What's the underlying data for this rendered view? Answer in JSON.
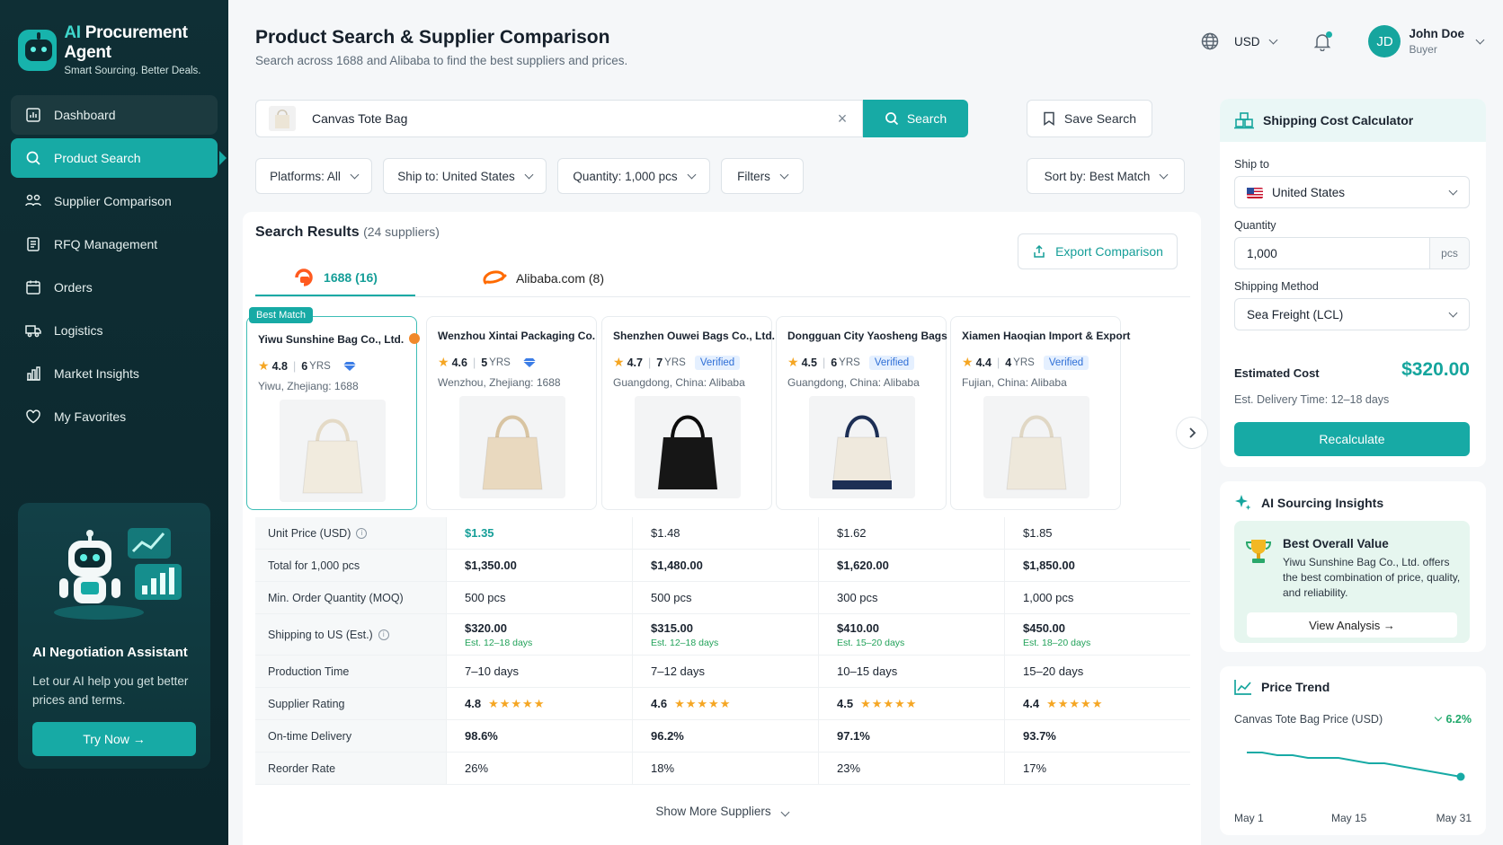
{
  "brand": {
    "title_prefix": "AI",
    "title_rest": " Procurement Agent",
    "subtitle": "Smart Sourcing. Better Deals."
  },
  "nav": [
    {
      "label": "Dashboard",
      "icon": "dashboard-icon"
    },
    {
      "label": "Product Search",
      "icon": "search-icon",
      "active": true
    },
    {
      "label": "Supplier Comparison",
      "icon": "supplier-comparison-icon"
    },
    {
      "label": "RFQ Management",
      "icon": "rfq-icon"
    },
    {
      "label": "Orders",
      "icon": "orders-icon"
    },
    {
      "label": "Logistics",
      "icon": "truck-icon"
    },
    {
      "label": "Market Insights",
      "icon": "chart-icon"
    },
    {
      "label": "My Favorites",
      "icon": "heart-icon"
    }
  ],
  "assistant": {
    "title": "AI Negotiation Assistant",
    "desc": "Let our AI help you get better prices and terms.",
    "button": "Try Now →"
  },
  "header": {
    "title": "Product Search & Supplier Comparison",
    "subtitle": "Search across 1688 and Alibaba to find the best suppliers and prices.",
    "currency": "USD",
    "user_initials": "JD",
    "user_name": "John Doe",
    "user_role": "Buyer"
  },
  "search": {
    "value": "Canvas Tote Bag",
    "button": "Search",
    "save": "Save Search"
  },
  "filters": {
    "platforms": "Platforms: All",
    "ship_to": "Ship to: United States",
    "quantity": "Quantity: 1,000 pcs",
    "filters": "Filters",
    "sort": "Sort by: Best Match"
  },
  "results": {
    "title": "Search Results",
    "count": "(24 suppliers)",
    "export": "Export Comparison",
    "tabs": {
      "t1688": "1688 (16)",
      "alibaba": "Alibaba.com (8)"
    },
    "best_tag": "Best Match",
    "show_more": "Show More Suppliers"
  },
  "suppliers": [
    {
      "name": "Yiwu Sunshine Bag Co., Ltd.",
      "rating": "4.8",
      "years": "6",
      "badge": "diamond",
      "location": "Yiwu, Zhejiang: 1688",
      "bag_color": "#f1ebde",
      "handle": "#e4dac6"
    },
    {
      "name": "Wenzhou Xintai Packaging Co.",
      "rating": "4.6",
      "years": "5",
      "badge": "diamond",
      "location": "Wenzhou, Zhejiang: 1688",
      "bag_color": "#e9d9bf",
      "handle": "#d8c4a2"
    },
    {
      "name": "Shenzhen Ouwei Bags Co., Ltd.",
      "rating": "4.7",
      "years": "7",
      "badge": "verified",
      "location": "Guangdong, China: Alibaba",
      "bag_color": "#161616",
      "handle": "#0c0c0c"
    },
    {
      "name": "Dongguan City Yaosheng Bags",
      "rating": "4.5",
      "years": "6",
      "badge": "verified",
      "location": "Guangdong, China: Alibaba",
      "bag_color": "#efe9dd",
      "handle": "#1d2f55"
    },
    {
      "name": "Xiamen Haoqian Import & Export",
      "rating": "4.4",
      "years": "4",
      "badge": "verified",
      "location": "Fujian, China: Alibaba",
      "bag_color": "#eee8db",
      "handle": "#e0d7c4"
    }
  ],
  "labels": {
    "yrs": "YRS",
    "verified": "Verified"
  },
  "table": {
    "rows": [
      {
        "label": "Unit Price (USD)",
        "info": true,
        "values": [
          "$1.35",
          "$1.48",
          "$1.62",
          "$1.85"
        ],
        "style": "price"
      },
      {
        "label": "Total for 1,000 pcs",
        "values": [
          "$1,350.00",
          "$1,480.00",
          "$1,620.00",
          "$1,850.00"
        ],
        "style": "bold"
      },
      {
        "label": "Min. Order Quantity (MOQ)",
        "values": [
          "500 pcs",
          "500 pcs",
          "300 pcs",
          "1,000 pcs"
        ],
        "style": "normal"
      },
      {
        "label": "Shipping to US (Est.)",
        "info": true,
        "values": [
          "$320.00",
          "$315.00",
          "$410.00",
          "$450.00"
        ],
        "subs": [
          "Est. 12–18 days",
          "Est. 12–18 days",
          "Est. 15–20 days",
          "Est. 18–20 days"
        ],
        "style": "bold"
      },
      {
        "label": "Production Time",
        "values": [
          "7–10 days",
          "7–12 days",
          "10–15 days",
          "15–20 days"
        ],
        "style": "normal"
      },
      {
        "label": "Supplier Rating",
        "values": [
          "4.8",
          "4.6",
          "4.5",
          "4.4"
        ],
        "stars": [
          "★★★★★",
          "★★★★★",
          "★★★★★",
          "★★★★★"
        ],
        "style": "bold"
      },
      {
        "label": "On-time Delivery",
        "values": [
          "98.6%",
          "96.2%",
          "97.1%",
          "93.7%"
        ],
        "style": "bold"
      },
      {
        "label": "Reorder Rate",
        "values": [
          "26%",
          "18%",
          "23%",
          "17%"
        ],
        "style": "normal"
      }
    ]
  },
  "shipping": {
    "title": "Shipping Cost Calculator",
    "ship_to_label": "Ship to",
    "ship_to": "United States",
    "quantity_label": "Quantity",
    "quantity": "1,000",
    "unit": "pcs",
    "method_label": "Shipping Method",
    "method": "Sea Freight (LCL)",
    "est_label": "Estimated Cost",
    "est_value": "$320.00",
    "est_time": "Est. Delivery Time: 12–18 days",
    "recalc": "Recalculate"
  },
  "insights": {
    "title": "AI Sourcing Insights",
    "box_title": "Best Overall Value",
    "box_text": "Yiwu Sunshine Bag Co., Ltd. offers the best combination of price, quality, and reliability.",
    "button": "View Analysis →"
  },
  "trend": {
    "title": "Price Trend",
    "subtitle": "Canvas Tote Bag Price (USD)",
    "change": "6.2%",
    "x_labels": [
      "May 1",
      "May 15",
      "May 31"
    ],
    "line_color": "#17aaa5"
  },
  "chart_data": {
    "type": "line",
    "title": "Price Trend",
    "subtitle": "Canvas Tote Bag Price (USD)",
    "x_ticks": [
      "May 1",
      "May 15",
      "May 31"
    ],
    "series": [
      {
        "values": [
          1.44,
          1.44,
          1.43,
          1.43,
          1.42,
          1.42,
          1.42,
          1.41,
          1.4,
          1.4,
          1.39,
          1.38,
          1.37,
          1.36,
          1.35
        ]
      }
    ],
    "change_pct": -6.2,
    "ylim": [
      1.3,
      1.5
    ],
    "grid": false
  }
}
